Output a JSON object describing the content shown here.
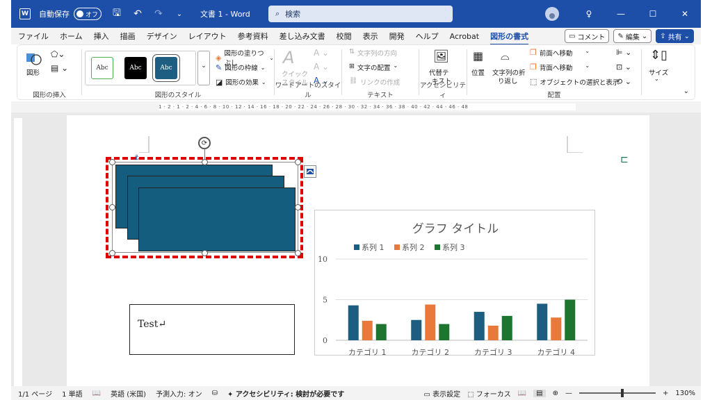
{
  "titlebar": {
    "autosave_label": "自動保存",
    "autosave_state": "オフ",
    "title": "文書 1 - Word",
    "search_placeholder": "検索",
    "word_letter": "W"
  },
  "menu": {
    "tabs": [
      "ファイル",
      "ホーム",
      "挿入",
      "描画",
      "デザイン",
      "レイアウト",
      "参考資料",
      "差し込み文書",
      "校閲",
      "表示",
      "開発",
      "ヘルプ",
      "Acrobat",
      "図形の書式"
    ],
    "active_tab": "図形の書式",
    "comment_label": "コメント",
    "edit_label": "編集",
    "share_label": "共有"
  },
  "ribbon": {
    "insert_shapes": {
      "label": "図形の挿入",
      "shape_label": "図形"
    },
    "shape_styles": {
      "label": "図形のスタイル",
      "style_text": "Abc",
      "fill": "図形の塗りつぶし",
      "outline": "図形の枠線",
      "effects": "図形の効果"
    },
    "wordart": {
      "label": "ワードアートのスタイル",
      "quick": "クイック",
      "style": "スタイル"
    },
    "text": {
      "label": "テキスト",
      "direction": "文字列の方向",
      "align": "文字の配置",
      "link": "リンクの作成"
    },
    "accessibility": {
      "label": "アクセシビリティ",
      "alt_1": "代替テ",
      "alt_2": "キスト"
    },
    "arrange": {
      "label": "配置",
      "position": "位置",
      "wrap_1": "文字列の折",
      "wrap_2": "り返し",
      "forward": "前面へ移動",
      "backward": "背面へ移動",
      "selection_pane": "オブジェクトの選択と表示"
    },
    "size": {
      "label": "サイズ"
    }
  },
  "ruler": {
    "ticks": "1 · 2 · 1 · 2 · 4 · 6 · 8 · 10 · 12 · 14 · 16 · 18 · 20 · 22 · 24 · 26 · 28 · 30 · 32 · 34 · 36 · 38 · 40 · 42 · 44 · 46 · 48"
  },
  "document": {
    "textbox_text": "Test↵",
    "shape_color": "#155d7f",
    "selection_color": "#e00000"
  },
  "chart_data": {
    "type": "bar",
    "title": "グラフ タイトル",
    "categories": [
      "カテゴリ 1",
      "カテゴリ 2",
      "カテゴリ 3",
      "カテゴリ 4"
    ],
    "series": [
      {
        "name": "系列 1",
        "values": [
          4.3,
          2.5,
          3.5,
          4.5
        ],
        "color": "#1c5d80"
      },
      {
        "name": "系列 2",
        "values": [
          2.4,
          4.4,
          1.8,
          2.8
        ],
        "color": "#e8793a"
      },
      {
        "name": "系列 3",
        "values": [
          2.0,
          2.0,
          3.0,
          5.0
        ],
        "color": "#1e7530"
      }
    ],
    "ylim": [
      0,
      10
    ],
    "yticks": [
      0,
      5,
      10
    ],
    "legend": "top",
    "grid": true
  },
  "status": {
    "page": "1/1 ページ",
    "words": "1 単語",
    "language": "英語 (米国)",
    "predictive": "予測入力: オン",
    "accessibility": "アクセシビリティ: 検討が必要です",
    "display_settings": "表示設定",
    "focus": "フォーカス",
    "zoom": "130%"
  }
}
